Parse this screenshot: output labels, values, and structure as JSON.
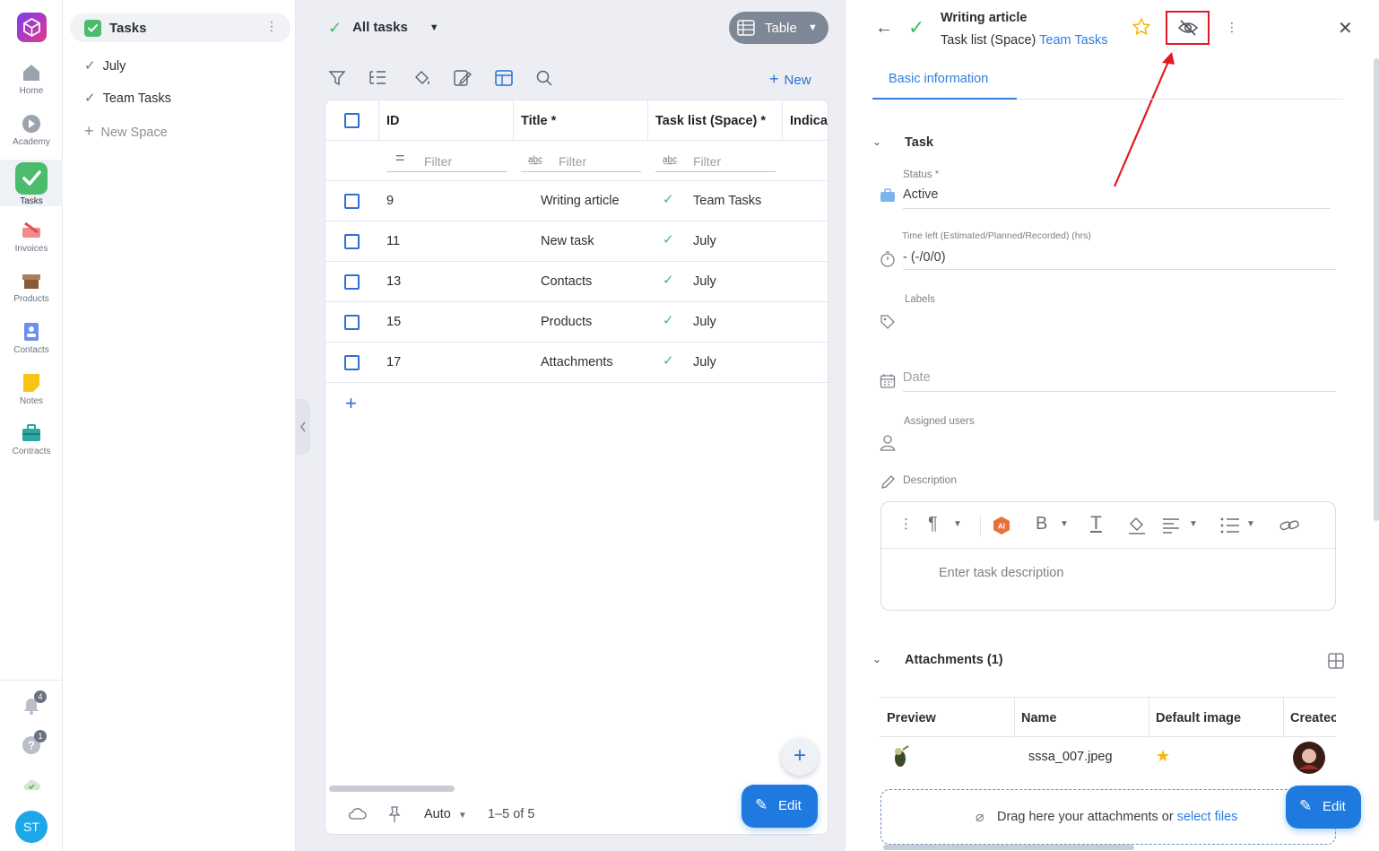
{
  "rail": {
    "items": [
      {
        "label": "Home"
      },
      {
        "label": "Academy"
      },
      {
        "label": "Tasks"
      },
      {
        "label": "Invoices"
      },
      {
        "label": "Products"
      },
      {
        "label": "Contacts"
      },
      {
        "label": "Notes"
      },
      {
        "label": "Contracts"
      }
    ],
    "notifications_badge": "4",
    "help_badge": "1",
    "avatar_initials": "ST"
  },
  "spaces": {
    "header": "Tasks",
    "items": [
      {
        "label": "July"
      },
      {
        "label": "Team Tasks"
      }
    ],
    "new_space": "New Space"
  },
  "list": {
    "view_title": "All tasks",
    "view_mode": "Table",
    "new_label": "New",
    "columns": [
      "ID",
      "Title *",
      "Task list (Space) *",
      "Indica"
    ],
    "filter_placeholder": "Filter",
    "rows": [
      {
        "id": "9",
        "title": "Writing article",
        "space": "Team Tasks"
      },
      {
        "id": "11",
        "title": "New task",
        "space": "July"
      },
      {
        "id": "13",
        "title": "Contacts",
        "space": "July"
      },
      {
        "id": "15",
        "title": "Products",
        "space": "July"
      },
      {
        "id": "17",
        "title": "Attachments",
        "space": "July"
      }
    ],
    "footer": {
      "size_mode": "Auto",
      "range": "1–5 of 5"
    },
    "edit_label": "Edit"
  },
  "detail": {
    "title": "Writing article",
    "subtitle_prefix": "Task list (Space)",
    "subtitle_link": "Team Tasks",
    "tab": "Basic information",
    "section_task": "Task",
    "status_label": "Status *",
    "status_value": "Active",
    "time_label": "Time left (Estimated/Planned/Recorded) (hrs)",
    "time_value": "- (-/0/0)",
    "labels_label": "Labels",
    "date_placeholder": "Date",
    "assigned_label": "Assigned users",
    "description_label": "Description",
    "description_placeholder": "Enter task description",
    "attachments_title": "Attachments (1)",
    "att_columns": [
      "Preview",
      "Name",
      "Default image",
      "Createc"
    ],
    "att_row": {
      "name": "sssa_007.jpeg"
    },
    "drop_text": "Drag here your attachments or",
    "drop_link": "select files",
    "edit_label": "Edit"
  },
  "colors": {
    "accent": "#1f7ae0",
    "check_green": "#44b86c",
    "highlight_red": "#e01b24",
    "star": "#f5b50a"
  }
}
